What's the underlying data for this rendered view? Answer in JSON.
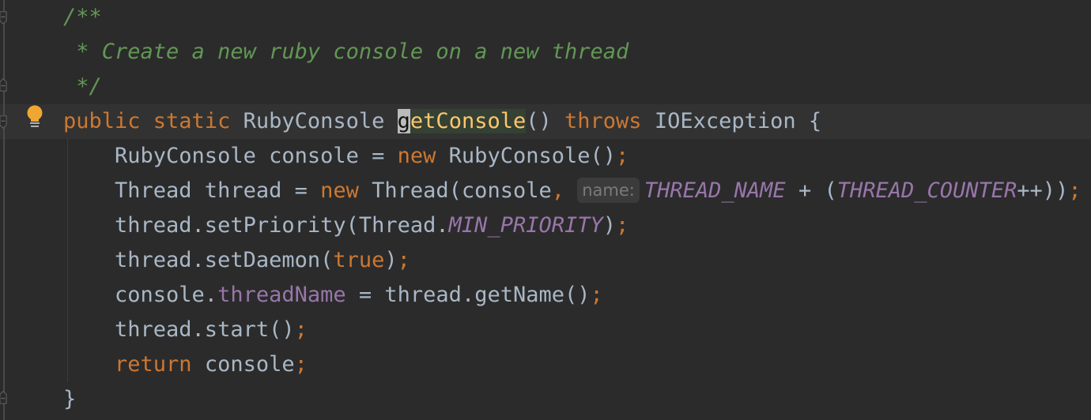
{
  "editor": {
    "lines": [
      [
        {
          "t": "cm",
          "v": "/**"
        }
      ],
      [
        {
          "t": "cm",
          "v": " * Create a new ruby console on a new thread"
        }
      ],
      [
        {
          "t": "cm",
          "v": " */"
        }
      ],
      [
        {
          "t": "kw",
          "v": "public static "
        },
        {
          "t": "pl",
          "v": "RubyConsole "
        },
        {
          "t": "caret",
          "v": "g"
        },
        {
          "t": "md decl",
          "v": "etConsole"
        },
        {
          "t": "pl",
          "v": "() "
        },
        {
          "t": "kw",
          "v": "throws "
        },
        {
          "t": "pl",
          "v": "IOException {"
        }
      ],
      [
        {
          "t": "pl",
          "v": "    RubyConsole console = "
        },
        {
          "t": "kw",
          "v": "new "
        },
        {
          "t": "pl",
          "v": "RubyConsole()"
        },
        {
          "t": "semi",
          "v": ";"
        }
      ],
      [
        {
          "t": "pl",
          "v": "    Thread thread = "
        },
        {
          "t": "kw",
          "v": "new "
        },
        {
          "t": "pl",
          "v": "Thread(console"
        },
        {
          "t": "semi",
          "v": ", "
        },
        {
          "t": "hint",
          "v": "name:"
        },
        {
          "t": "const",
          "v": "THREAD_NAME"
        },
        {
          "t": "pl",
          "v": " + ("
        },
        {
          "t": "const",
          "v": "THREAD_COUNTER"
        },
        {
          "t": "pl",
          "v": "++))"
        },
        {
          "t": "semi",
          "v": ";"
        }
      ],
      [
        {
          "t": "pl",
          "v": "    thread.setPriority(Thread."
        },
        {
          "t": "const",
          "v": "MIN_PRIORITY"
        },
        {
          "t": "pl",
          "v": ")"
        },
        {
          "t": "semi",
          "v": ";"
        }
      ],
      [
        {
          "t": "pl",
          "v": "    thread.setDaemon("
        },
        {
          "t": "kw",
          "v": "true"
        },
        {
          "t": "pl",
          "v": ")"
        },
        {
          "t": "semi",
          "v": ";"
        }
      ],
      [
        {
          "t": "pl",
          "v": "    console."
        },
        {
          "t": "field",
          "v": "threadName"
        },
        {
          "t": "pl",
          "v": " = thread.getName()"
        },
        {
          "t": "semi",
          "v": ";"
        }
      ],
      [
        {
          "t": "pl",
          "v": "    thread.start()"
        },
        {
          "t": "semi",
          "v": ";"
        }
      ],
      [
        {
          "t": "kw",
          "v": "    return "
        },
        {
          "t": "pl",
          "v": "console"
        },
        {
          "t": "semi",
          "v": ";"
        }
      ],
      [
        {
          "t": "pl",
          "v": "}"
        }
      ]
    ],
    "icons": {
      "intention": "lightbulb-icon",
      "fold": "fold-marker-icon"
    },
    "colors": {
      "background": "#2b2b2b",
      "keyword": "#cc7832",
      "comment": "#629755",
      "text": "#a9b7c6",
      "method": "#ffc66d",
      "constant": "#9876aa"
    }
  }
}
